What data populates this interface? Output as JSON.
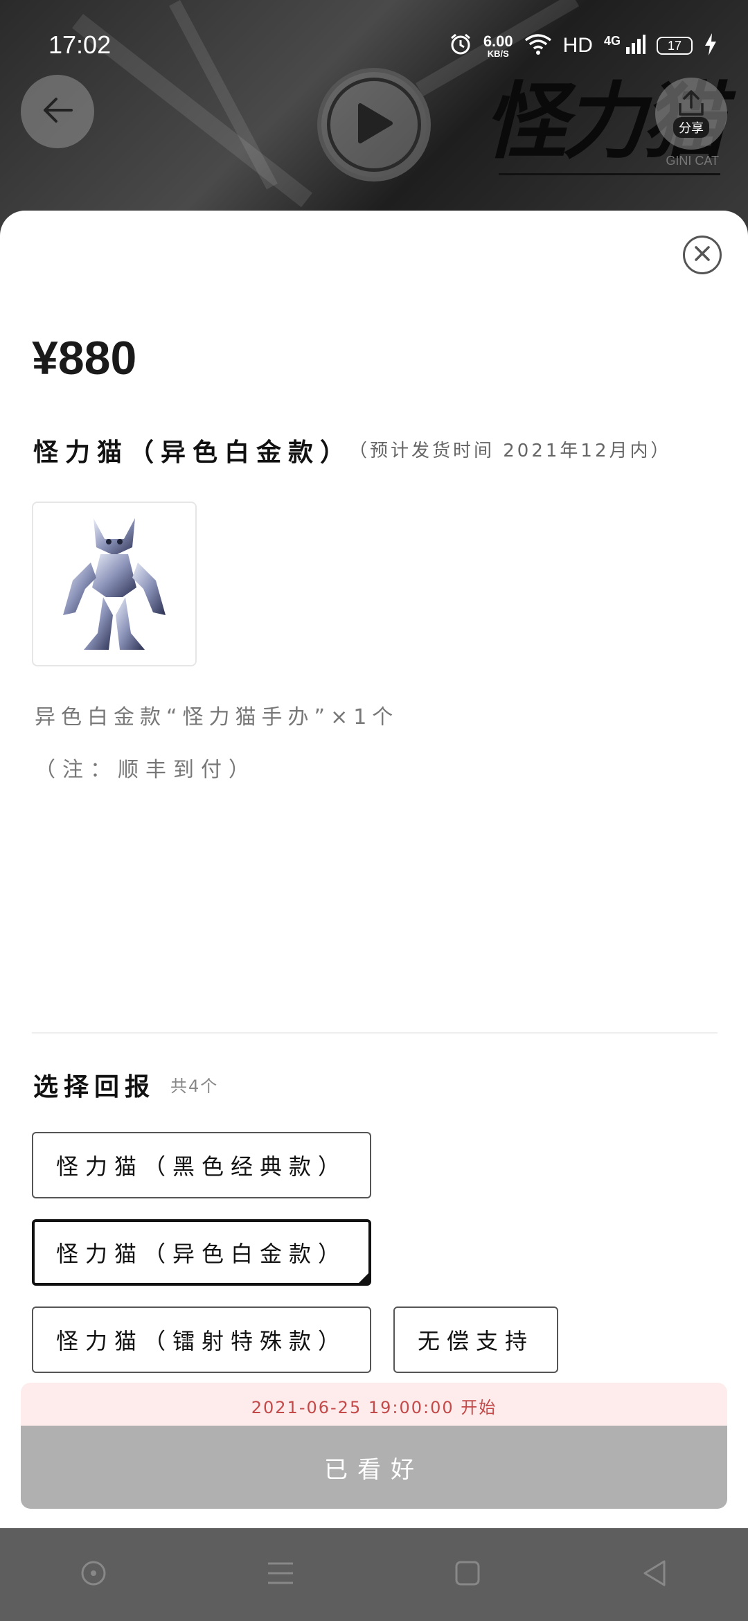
{
  "status_bar": {
    "time": "17:02",
    "net_speed_value": "6.00",
    "net_speed_unit": "KB/S",
    "hd_label": "HD",
    "network_label": "4G",
    "battery_level": "17"
  },
  "header": {
    "brand_logo": "怪力猫",
    "brand_sub": "GINI CAT",
    "share_label": "分享"
  },
  "product": {
    "price": "¥880",
    "title": "怪力猫（异色白金款）",
    "ship_note": "（预计发货时间 2021年12月内）",
    "description": "异色白金款“怪力猫手办”×1个",
    "note": "（注：顺丰到付）"
  },
  "rewards": {
    "title": "选择回报",
    "count": "共4个",
    "options": [
      {
        "label": "怪力猫（黑色经典款）",
        "selected": false
      },
      {
        "label": "怪力猫（异色白金款）",
        "selected": true
      },
      {
        "label": "怪力猫（镭射特殊款）",
        "selected": false
      },
      {
        "label": "无偿支持",
        "selected": false
      }
    ]
  },
  "footer": {
    "start_time": "2021-06-25 19:00:00 开始",
    "action_label": "已看好"
  },
  "colors": {
    "banner_bg": "#fdeceb",
    "banner_text": "#c44a4a",
    "action_bg": "#b0b0b0"
  }
}
